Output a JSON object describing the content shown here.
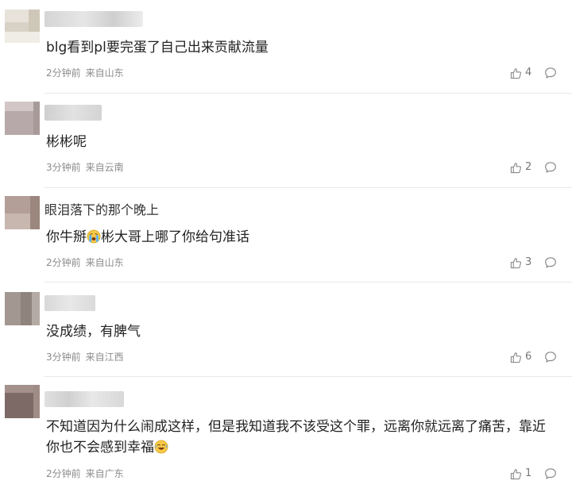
{
  "comments": [
    {
      "text": "blg看到pl要完蛋了自己出来贡献流量",
      "time": "2分钟前",
      "location": "来自山东",
      "likes": "4"
    },
    {
      "text": "彬彬呢",
      "time": "3分钟前",
      "location": "来自云南",
      "likes": "2"
    },
    {
      "username": "眼泪落下的那个晚上",
      "text_before_emoji": "你牛掰",
      "emoji": "crying-face-emoji",
      "text_after_emoji": "彬大哥上哪了你给句准话",
      "time": "2分钟前",
      "location": "来自山东",
      "likes": "3"
    },
    {
      "text": "没成绩，有脾气",
      "time": "3分钟前",
      "location": "来自江西",
      "likes": "6"
    },
    {
      "text_before_emoji": "不知道因为什么闹成这样，但是我知道我不该受这个罪，远离你就远离了痛苦，靠近你也不会感到幸福",
      "emoji": "laughing-crying-face-emoji",
      "time": "2分钟前",
      "location": "来自广东",
      "likes": "1"
    }
  ],
  "icons": {
    "like": "thumbs-up-icon",
    "reply": "speech-bubble-icon"
  },
  "colors": {
    "meta_text": "#8c8c8c",
    "divider": "#e9e9e9",
    "icon": "#8a8a8a"
  }
}
